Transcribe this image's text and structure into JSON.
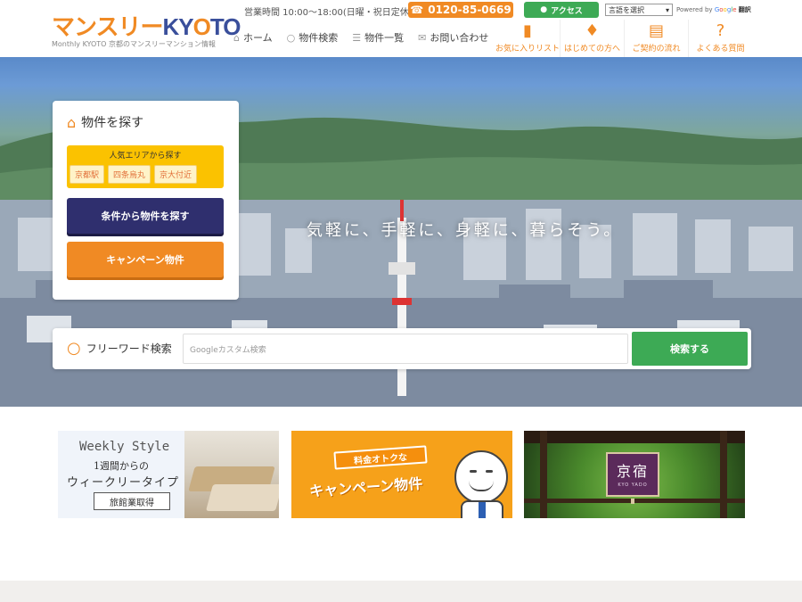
{
  "header": {
    "logo_kana": "マンスリー",
    "logo_kyoto_pre": "KY",
    "logo_kyoto_o": "O",
    "logo_kyoto_post": "TO",
    "logo_sub": "Monthly KYOTO 京都のマンスリーマンション情報",
    "hours": "営業時間 10:00〜18:00(日曜・祝日定休)",
    "tel": "0120-85-0669",
    "access": "アクセス",
    "lang_select": "言語を選択",
    "powered_by": "Powered by",
    "google": [
      "G",
      "o",
      "o",
      "g",
      "l",
      "e"
    ],
    "translate": "翻訳",
    "main_nav": [
      {
        "label": "ホーム",
        "icon": "home-icon"
      },
      {
        "label": "物件検索",
        "icon": "search-icon"
      },
      {
        "label": "物件一覧",
        "icon": "list-icon"
      },
      {
        "label": "お問い合わせ",
        "icon": "mail-icon"
      }
    ],
    "sub_nav": [
      {
        "label": "お気に入りリスト",
        "icon": "bookmark-icon"
      },
      {
        "label": "はじめての方へ",
        "icon": "beginner-mark-icon"
      },
      {
        "label": "ご契約の流れ",
        "icon": "clipboard-icon"
      },
      {
        "label": "よくある質問",
        "icon": "question-icon"
      }
    ]
  },
  "hero": {
    "catchphrase": "気軽に、手軽に、身軽に、暮らそう。"
  },
  "search_card": {
    "title": "物件を探す",
    "area_heading": "人気エリアから探す",
    "areas": [
      "京都駅",
      "四条烏丸",
      "京大付近"
    ],
    "condition_button": "条件から物件を探す",
    "campaign_button": "キャンペーン物件"
  },
  "freeword": {
    "label": "フリーワード検索",
    "placeholder": "Googleカスタム検索",
    "button": "検索する"
  },
  "banners": {
    "weekly": {
      "en": "Weekly Style",
      "jp1": "1週間からの",
      "jp2": "ウィークリータイプ",
      "tag": "旅館業取得"
    },
    "campaign": {
      "ribbon": "料金オトクな",
      "big": "キャンペーン物件"
    },
    "kyoyado": {
      "kanji": "京宿",
      "roman": "KYO YADO"
    }
  },
  "colors": {
    "accent": "#f08a24",
    "navy": "#2f2f6e",
    "green": "#3daa55",
    "yellow": "#fbc200"
  }
}
